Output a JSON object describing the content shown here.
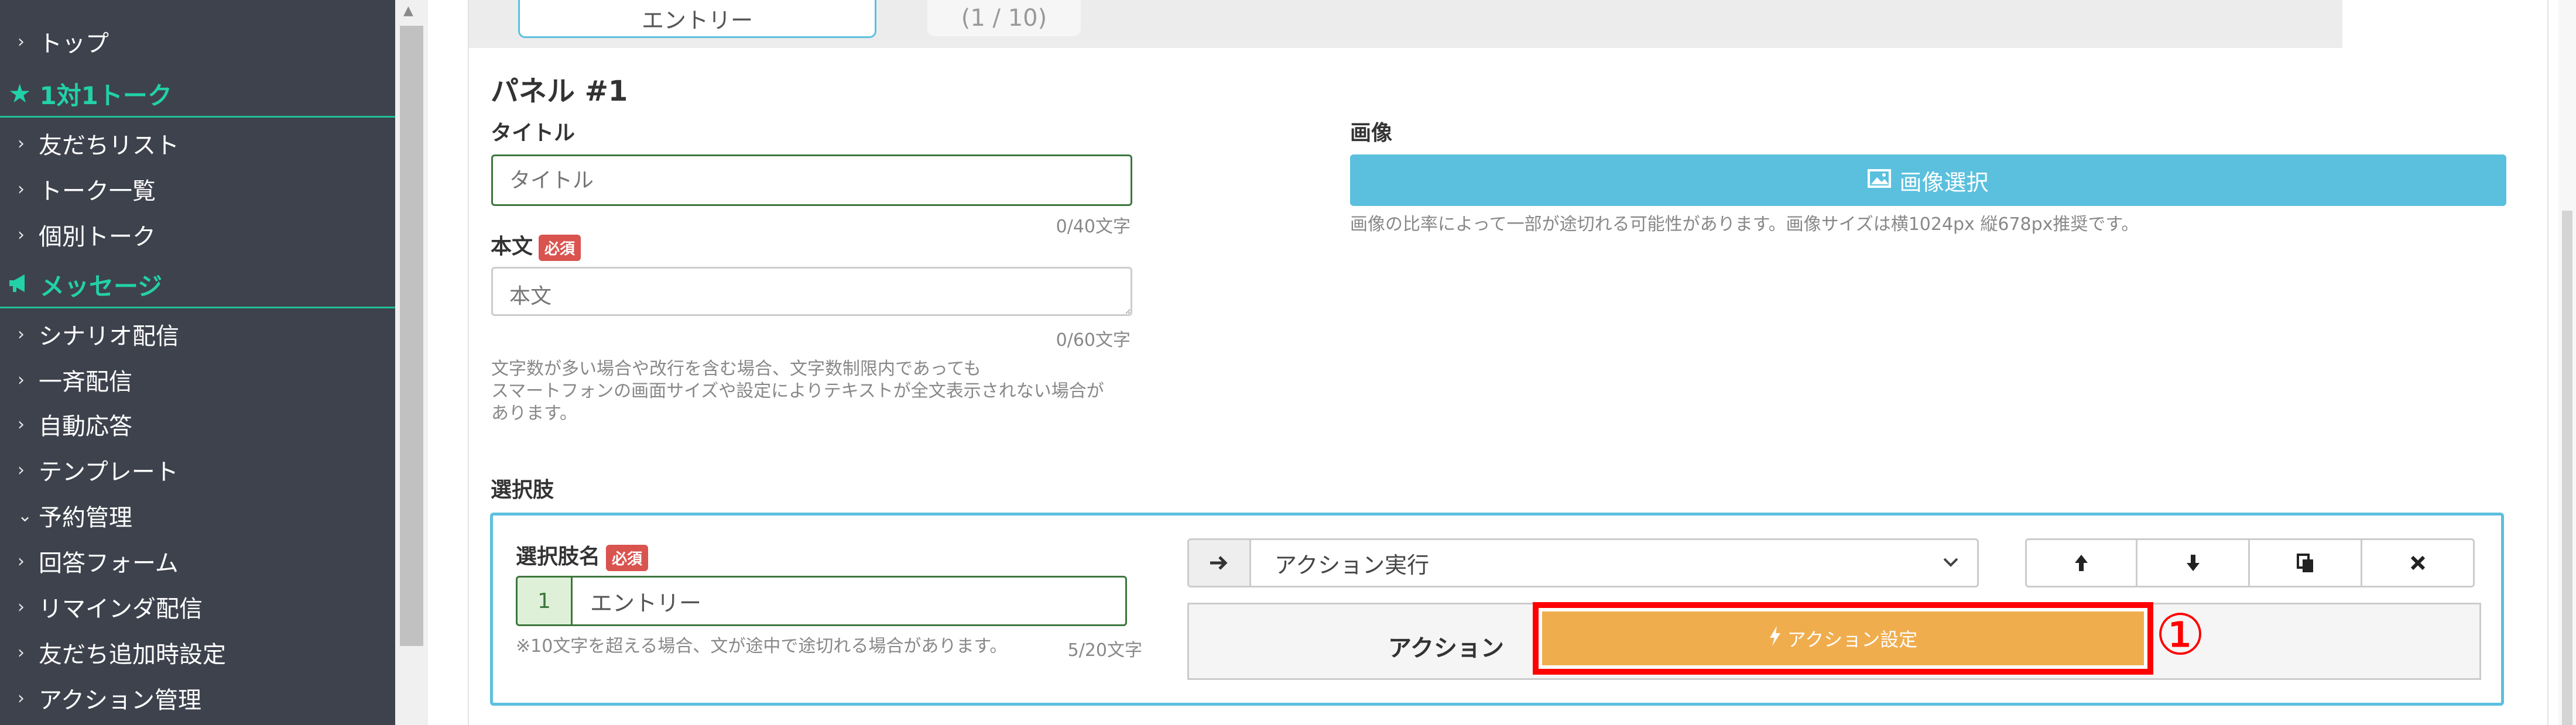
{
  "sidebar": {
    "items": [
      {
        "label": "トップ",
        "icon": "chevron-right-icon"
      },
      {
        "section": "1対1トーク",
        "icon": "star-icon"
      },
      {
        "label": "友だちリスト",
        "icon": "chevron-right-icon"
      },
      {
        "label": "トーク一覧",
        "icon": "chevron-right-icon"
      },
      {
        "label": "個別トーク",
        "icon": "chevron-right-icon"
      },
      {
        "section": "メッセージ",
        "icon": "megaphone-icon"
      },
      {
        "label": "シナリオ配信",
        "icon": "chevron-right-icon"
      },
      {
        "label": "一斉配信",
        "icon": "chevron-right-icon"
      },
      {
        "label": "自動応答",
        "icon": "chevron-right-icon"
      },
      {
        "label": "テンプレート",
        "icon": "chevron-right-icon"
      },
      {
        "label": "予約管理",
        "icon": "chevron-down-icon"
      },
      {
        "label": "回答フォーム",
        "icon": "chevron-right-icon"
      },
      {
        "label": "リマインダ配信",
        "icon": "chevron-right-icon"
      },
      {
        "label": "友だち追加時設定",
        "icon": "chevron-right-icon"
      },
      {
        "label": "アクション管理",
        "icon": "chevron-right-icon"
      }
    ]
  },
  "tabs": {
    "active_label": "エントリー",
    "counter": "(1 / 10)"
  },
  "panel": {
    "title": "パネル #1",
    "title_field": {
      "label": "タイトル",
      "placeholder": "タイトル",
      "counter": "0/40文字"
    },
    "body_field": {
      "label": "本文",
      "required": "必須",
      "placeholder": "本文",
      "counter": "0/60文字"
    },
    "body_note": [
      "文字数が多い場合や改行を含む場合、文字数制限内であっても",
      "スマートフォンの画面サイズや設定によりテキストが全文表示されない場合が",
      "あります。"
    ],
    "image": {
      "label": "画像",
      "button": "画像選択",
      "note": "画像の比率によって一部が途切れる可能性があります。画像サイズは横1024px 縦678px推奨です。"
    }
  },
  "choices": {
    "label": "選択肢",
    "name_label": "選択肢名",
    "required": "必須",
    "index": "1",
    "name_value": "エントリー",
    "name_note": "※10文字を超える場合、文が途中で途切れる場合があります。",
    "name_counter": "5/20文字",
    "action_select": "アクション実行",
    "action_label": "アクション",
    "action_button": "アクション設定",
    "callout": "①"
  },
  "colors": {
    "sidebar_bg": "#3e424d",
    "sidebar_accent": "#22d1a8",
    "info": "#5bc0de",
    "danger": "#d9534f",
    "warning": "#f0ad4e",
    "highlight_red": "#ff0000"
  }
}
